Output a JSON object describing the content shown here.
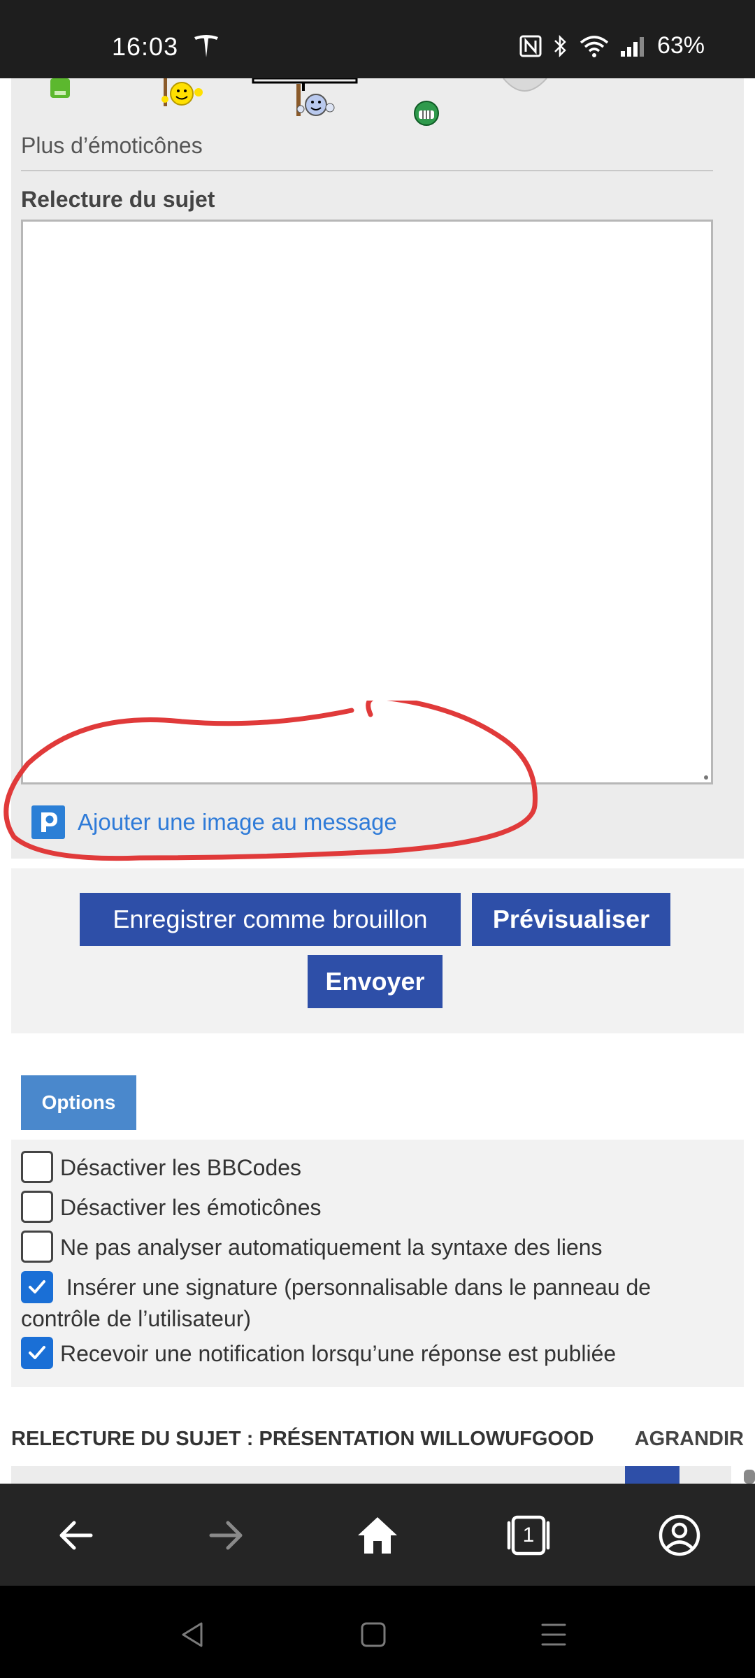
{
  "status_bar": {
    "time": "16:03",
    "battery": "63%",
    "icons": [
      "tesla-icon",
      "nfc-icon",
      "bluetooth-icon",
      "wifi-icon",
      "signal-icon"
    ]
  },
  "editor": {
    "more_emoticons": "Plus d’émoticônes",
    "review_label": "Relecture du sujet",
    "textarea_value": "",
    "add_image": "Ajouter une image au message"
  },
  "actions": {
    "save_draft": "Enregistrer comme brouillon",
    "preview": "Prévisualiser",
    "send": "Envoyer"
  },
  "options": {
    "tab_label": "Options",
    "items": [
      {
        "label": "Désactiver les BBCodes",
        "checked": false
      },
      {
        "label": "Désactiver les émoticônes",
        "checked": false
      },
      {
        "label": "Ne pas analyser automatiquement la syntaxe des liens",
        "checked": false
      },
      {
        "label": "Insérer une signature (personnalisable dans le panneau de contrôle de l’utilisateur)",
        "checked": true
      },
      {
        "label": "Recevoir une notification lorsqu’une réponse est publiée",
        "checked": true
      }
    ]
  },
  "topic_review": {
    "title": "RELECTURE DU SUJET : PRÉSENTATION WILLOWUFGOOD",
    "expand": "AGRANDIR"
  },
  "colors": {
    "button": "#2e4fa8",
    "options_tab": "#4a88cc",
    "link": "#2f7bd8",
    "annotation": "#e03a3a",
    "checkbox_checked": "#1a6fd6"
  },
  "browser_bar": {
    "tab_count": "1",
    "icons": [
      "back-arrow-icon",
      "forward-arrow-icon",
      "home-icon",
      "tabs-icon",
      "account-icon"
    ]
  }
}
